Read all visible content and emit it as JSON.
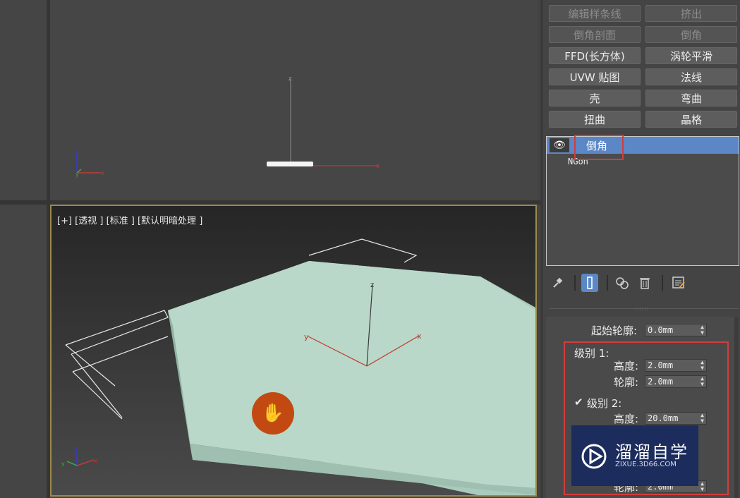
{
  "viewport": {
    "label": "[+] [透视 ] [标准 ] [默认明暗处理 ]"
  },
  "modifier_buttons": [
    {
      "label": "编辑样条线",
      "enabled": false
    },
    {
      "label": "挤出",
      "enabled": false
    },
    {
      "label": "倒角剖面",
      "enabled": false
    },
    {
      "label": "倒角",
      "enabled": false
    },
    {
      "label": "FFD(长方体)",
      "enabled": true
    },
    {
      "label": "涡轮平滑",
      "enabled": true
    },
    {
      "label": "UVW 贴图",
      "enabled": true
    },
    {
      "label": "法线",
      "enabled": true
    },
    {
      "label": "壳",
      "enabled": true
    },
    {
      "label": "弯曲",
      "enabled": true
    },
    {
      "label": "扭曲",
      "enabled": true
    },
    {
      "label": "晶格",
      "enabled": true
    }
  ],
  "modifier_stack": {
    "selected": "倒角",
    "base": "NGon"
  },
  "toolbar": {
    "pin": "pin-stack-icon",
    "show_end_result": "show-end-result-icon",
    "make_unique": "make-unique-icon",
    "remove_modifier": "remove-modifier-icon",
    "configure_sets": "configure-modifier-sets-icon"
  },
  "params": {
    "start_outline_label": "起始轮廓:",
    "start_outline_value": "0.0mm",
    "level1_label": "级别 1:",
    "level1_height_label": "高度:",
    "level1_height_value": "2.0mm",
    "level1_outline_label": "轮廓:",
    "level1_outline_value": "2.0mm",
    "level2_label": "级别 2:",
    "level2_checked": true,
    "level2_height_label": "高度:",
    "level2_height_value": "20.0mm",
    "level3_outline_label": "轮廓:",
    "level3_outline_value": "2.0mm"
  },
  "watermark": {
    "title": "溜溜自学",
    "url": "ZIXUE.3D66.COM"
  },
  "colors": {
    "selection_blue": "#5b87c6",
    "highlight_red": "#d43c3c",
    "object_color": "#b9d8c9",
    "hand_button": "#c24a12",
    "watermark_bg": "#1c2c5c"
  }
}
